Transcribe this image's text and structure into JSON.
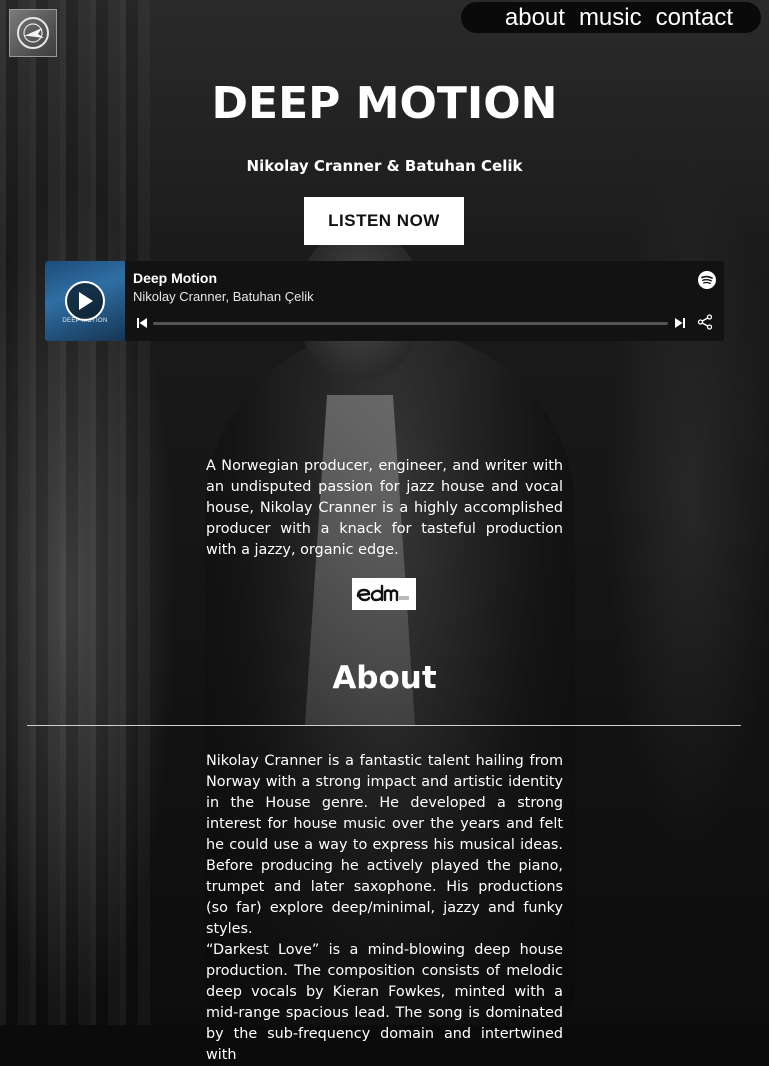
{
  "nav": {
    "about": "about",
    "music": "music",
    "contact": "contact"
  },
  "hero": {
    "title": "DEEP MOTION",
    "artists": "Nikolay Cranner & Batuhan Celik",
    "listen_label": "LISTEN NOW"
  },
  "player": {
    "track_title": "Deep Motion",
    "track_artist": "Nikolay Cranner, Batuhan Çelik",
    "cover_text": "DEEP MOTION",
    "progress": 0.0
  },
  "intro_text": "A Norwegian producer, engineer, and writer with an undisputed passion for jazz house and vocal house, Nikolay Cranner is a highly accomplished producer with a knack for tasteful production with a jazzy, organic edge.",
  "press_logo": "edm",
  "about": {
    "heading": "About",
    "paragraph1": "Nikolay Cranner is a fantastic talent hailing from Norway with a strong impact and artistic identity in the House genre. He developed a strong interest for house music over the years and felt he could use a way to express his musical ideas. Before producing he actively played the piano, trumpet and later saxophone. His productions (so far) explore deep/minimal, jazzy and funky styles.",
    "paragraph2": "“Darkest Love” is a mind-blowing deep house production. The composition consists of melodic deep vocals by Kieran Fowkes, minted with a mid-range spacious lead. The song is dominated by the sub-frequency domain and intertwined with"
  }
}
